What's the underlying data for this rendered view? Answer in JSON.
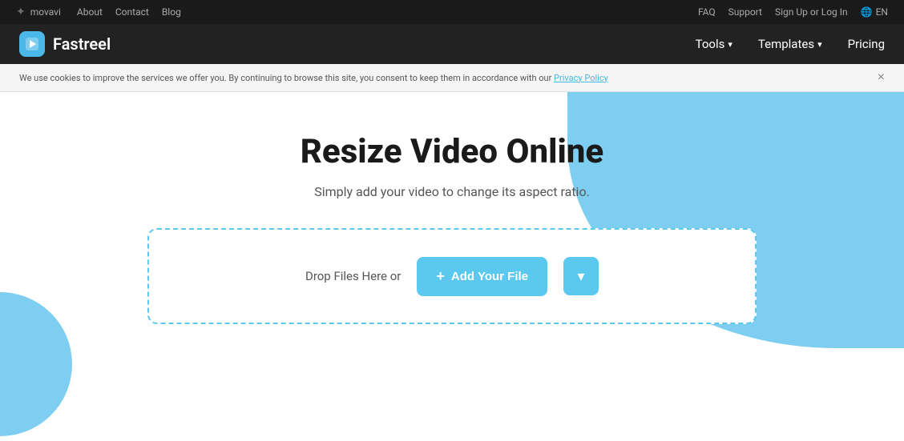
{
  "topbar": {
    "movavi_label": "movavi",
    "nav": {
      "about": "About",
      "contact": "Contact",
      "blog": "Blog"
    },
    "right": {
      "faq": "FAQ",
      "support": "Support",
      "signin": "Sign Up or Log In",
      "lang": "EN"
    }
  },
  "mainnav": {
    "brand": "Fastreel",
    "tools": "Tools",
    "templates": "Templates",
    "pricing": "Pricing"
  },
  "cookie": {
    "text": "We use cookies to improve the services we offer you. By continuing to browse this site, you consent to keep them in accordance with our ",
    "link_text": "Privacy Policy",
    "close_label": "×"
  },
  "hero": {
    "title": "Resize Video Online",
    "subtitle": "Simply add your video to change its aspect ratio.",
    "drop_label": "Drop Files Here or",
    "add_button": "Add Your File",
    "plus_icon": "+"
  }
}
